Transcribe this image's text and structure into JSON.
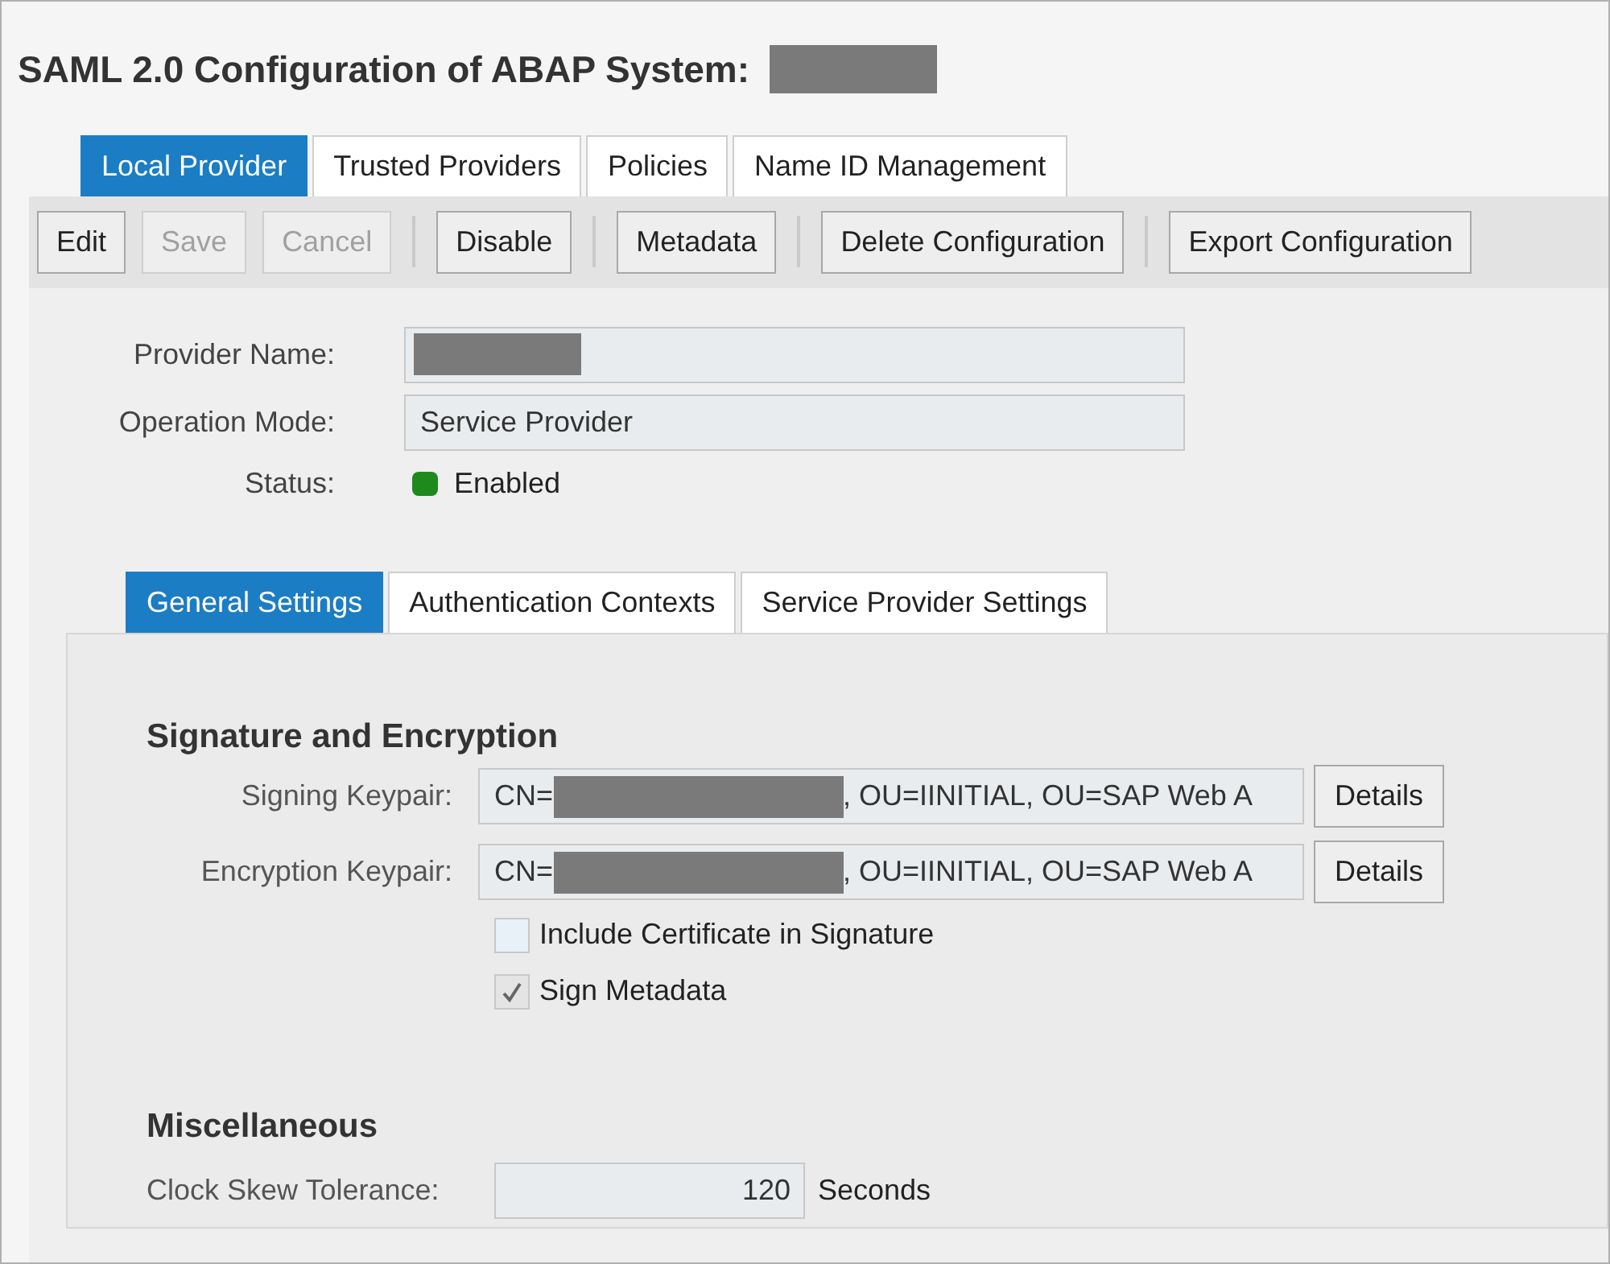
{
  "title": "SAML 2.0 Configuration of ABAP System:",
  "tabs": [
    {
      "label": "Local Provider",
      "selected": true
    },
    {
      "label": "Trusted Providers",
      "selected": false
    },
    {
      "label": "Policies",
      "selected": false
    },
    {
      "label": "Name ID Management",
      "selected": false
    }
  ],
  "toolbar": [
    [
      {
        "label": "Edit",
        "disabled": false
      },
      {
        "label": "Save",
        "disabled": true
      },
      {
        "label": "Cancel",
        "disabled": true
      }
    ],
    [
      {
        "label": "Disable",
        "disabled": false
      }
    ],
    [
      {
        "label": "Metadata",
        "disabled": false
      }
    ],
    [
      {
        "label": "Delete Configuration",
        "disabled": false
      }
    ],
    [
      {
        "label": "Export Configuration",
        "disabled": false
      }
    ]
  ],
  "provider": {
    "name_label": "Provider Name:",
    "mode_label": "Operation Mode:",
    "mode_value": "Service Provider",
    "status_label": "Status:",
    "status_value": "Enabled",
    "enabled": true
  },
  "sub_tabs": [
    {
      "label": "General Settings",
      "selected": true
    },
    {
      "label": "Authentication Contexts",
      "selected": false
    },
    {
      "label": "Service Provider Settings",
      "selected": false
    }
  ],
  "signature": {
    "heading": "Signature and Encryption",
    "keypairs": [
      {
        "label": "Signing Keypair:",
        "prefix": "CN=",
        "suffix": ", OU=IINITIAL, OU=SAP Web A",
        "button": "Details"
      },
      {
        "label": "Encryption Keypair:",
        "prefix": "CN=",
        "suffix": ", OU=IINITIAL, OU=SAP Web A",
        "button": "Details"
      }
    ],
    "checkboxes": [
      {
        "label": "Include Certificate in Signature",
        "checked": false
      },
      {
        "label": "Sign Metadata",
        "checked": true
      }
    ]
  },
  "misc": {
    "heading": "Miscellaneous",
    "label": "Clock Skew Tolerance:",
    "value": "120",
    "unit": "Seconds"
  }
}
